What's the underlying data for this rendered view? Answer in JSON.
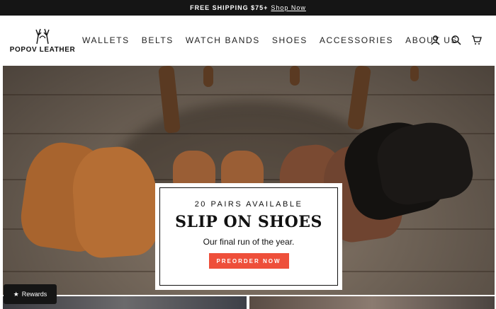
{
  "announcement": {
    "text": "FREE SHIPPING $75+",
    "link": "Shop Now"
  },
  "logo": {
    "text": "POPOV LEATHER"
  },
  "nav": {
    "items": [
      "WALLETS",
      "BELTS",
      "WATCH BANDS",
      "SHOES",
      "ACCESSORIES",
      "ABOUT US"
    ]
  },
  "header_icons": [
    "account-icon",
    "search-icon",
    "cart-icon"
  ],
  "hero": {
    "eyebrow": "20 PAIRS AVAILABLE",
    "title": "SLIP ON SHOES",
    "subtitle": "Our final run of the year.",
    "cta": "PREORDER NOW"
  },
  "rewards": {
    "label": "Rewards",
    "icon": "star-icon"
  },
  "colors": {
    "accent": "#ee4f3a",
    "dark": "#151515"
  }
}
